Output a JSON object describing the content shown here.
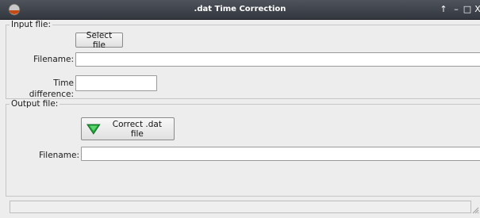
{
  "window": {
    "title": ".dat Time Correction",
    "controls": {
      "pin": "↑",
      "minimize": "–",
      "maximize": "□",
      "close": "X"
    }
  },
  "input_group": {
    "legend": "Input flie:",
    "select_button_label": "Select file",
    "filename_label": "Filename:",
    "filename_value": "",
    "time_difference_label": "Time difference:",
    "time_difference_value": ""
  },
  "output_group": {
    "legend": "Output file:",
    "correct_button_label": "Correct .dat file",
    "correct_button_icon": "green-triangle-down-icon",
    "filename_label": "Filename:",
    "filename_value": ""
  },
  "colors": {
    "titlebar": "#3a3e45",
    "accent_green": "#1fa83a"
  }
}
